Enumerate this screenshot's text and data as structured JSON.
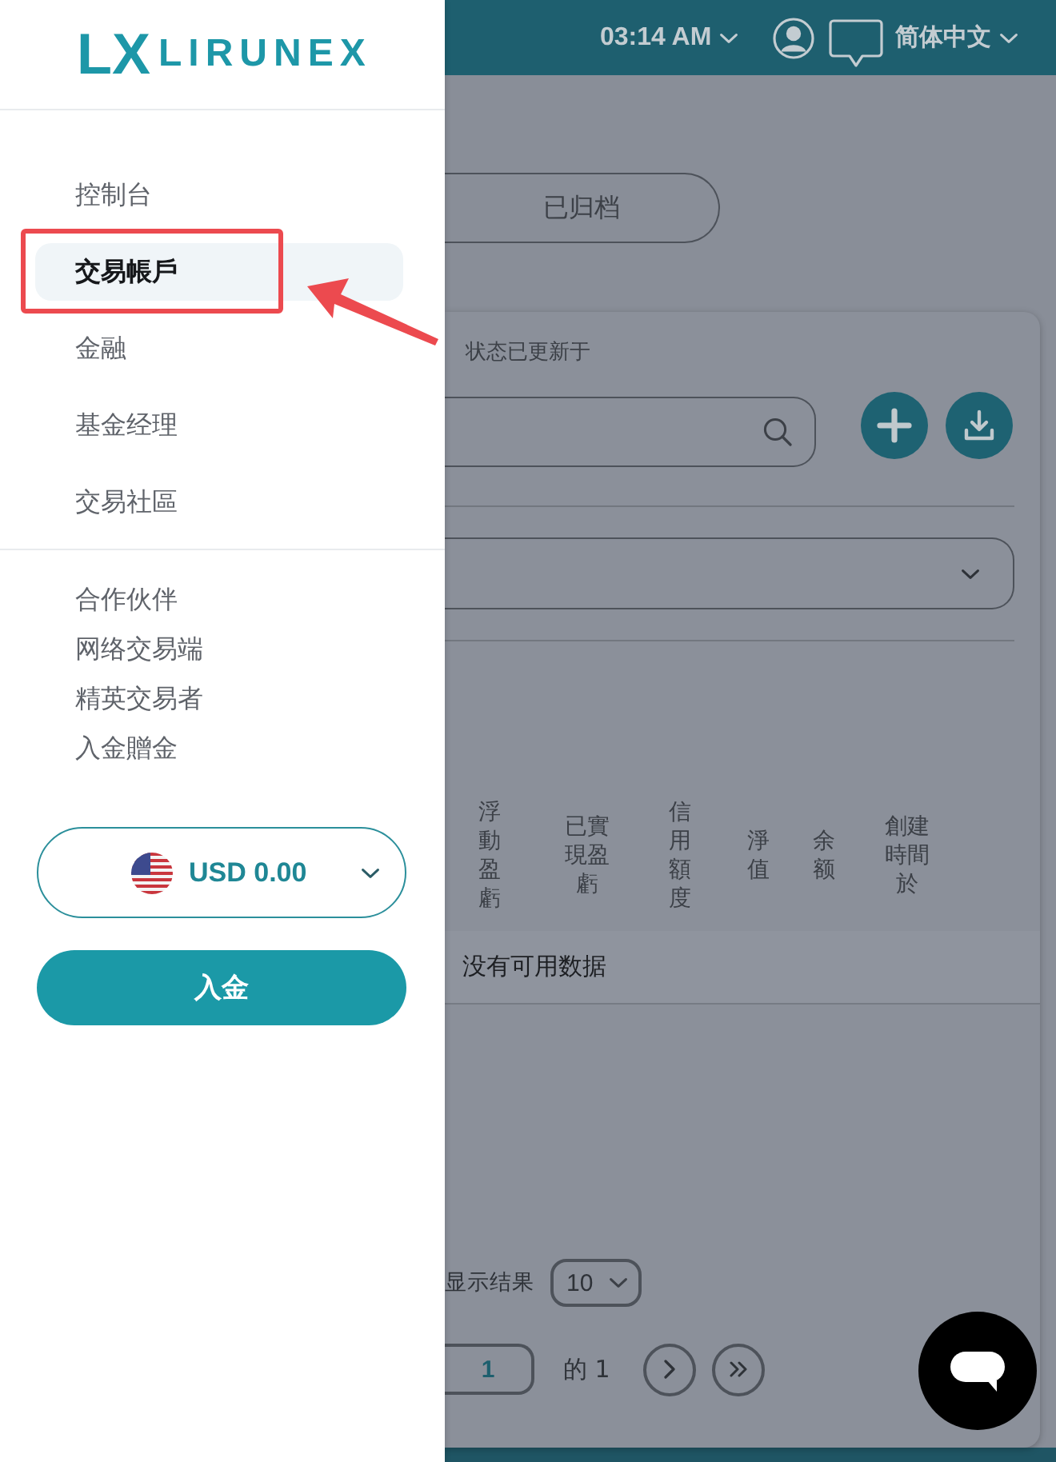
{
  "sidebar": {
    "logo": {
      "mark": "LX",
      "name": "LIRUNEX"
    },
    "nav": [
      {
        "label": "控制台",
        "selected": false,
        "marked": false
      },
      {
        "label": "交易帳戶",
        "selected": true,
        "marked": true
      },
      {
        "label": "金融",
        "selected": false,
        "marked": false
      },
      {
        "label": "基金经理",
        "selected": false,
        "marked": false
      },
      {
        "label": "交易社區",
        "selected": false,
        "marked": false
      }
    ],
    "links": [
      "合作伙伴",
      "网络交易端",
      "精英交易者",
      "入金贈金"
    ],
    "balance": "USD 0.00",
    "deposit_button": "入金"
  },
  "header": {
    "time": "03:14 AM",
    "language": "简体中文"
  },
  "tabs": [
    {
      "label": "已归档",
      "selected": false
    }
  ],
  "account_list": {
    "status_label": "状态已更新于",
    "table": {
      "columns": [
        "浮動盈虧",
        "已實現盈虧",
        "信用額度",
        "淨值",
        "余额",
        "創建時間於"
      ],
      "empty_message": "没有可用数据"
    },
    "pagination": {
      "page_size_label": "显示结果",
      "page_size": "10",
      "page": "1",
      "page_count": "的 1"
    }
  }
}
